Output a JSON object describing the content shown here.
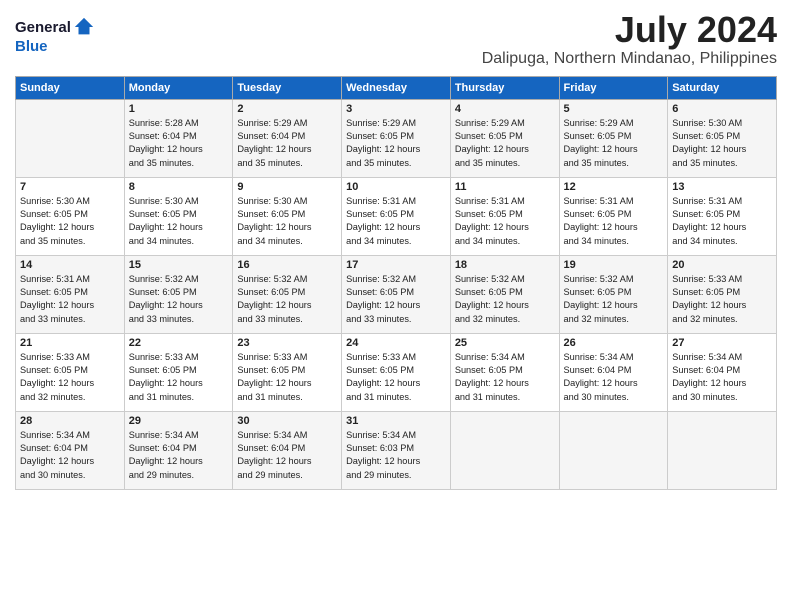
{
  "header": {
    "logo_general": "General",
    "logo_blue": "Blue",
    "month_year": "July 2024",
    "location": "Dalipuga, Northern Mindanao, Philippines"
  },
  "days_of_week": [
    "Sunday",
    "Monday",
    "Tuesday",
    "Wednesday",
    "Thursday",
    "Friday",
    "Saturday"
  ],
  "weeks": [
    [
      {
        "day": "",
        "info": ""
      },
      {
        "day": "1",
        "info": "Sunrise: 5:28 AM\nSunset: 6:04 PM\nDaylight: 12 hours\nand 35 minutes."
      },
      {
        "day": "2",
        "info": "Sunrise: 5:29 AM\nSunset: 6:04 PM\nDaylight: 12 hours\nand 35 minutes."
      },
      {
        "day": "3",
        "info": "Sunrise: 5:29 AM\nSunset: 6:05 PM\nDaylight: 12 hours\nand 35 minutes."
      },
      {
        "day": "4",
        "info": "Sunrise: 5:29 AM\nSunset: 6:05 PM\nDaylight: 12 hours\nand 35 minutes."
      },
      {
        "day": "5",
        "info": "Sunrise: 5:29 AM\nSunset: 6:05 PM\nDaylight: 12 hours\nand 35 minutes."
      },
      {
        "day": "6",
        "info": "Sunrise: 5:30 AM\nSunset: 6:05 PM\nDaylight: 12 hours\nand 35 minutes."
      }
    ],
    [
      {
        "day": "7",
        "info": "Sunrise: 5:30 AM\nSunset: 6:05 PM\nDaylight: 12 hours\nand 35 minutes."
      },
      {
        "day": "8",
        "info": "Sunrise: 5:30 AM\nSunset: 6:05 PM\nDaylight: 12 hours\nand 34 minutes."
      },
      {
        "day": "9",
        "info": "Sunrise: 5:30 AM\nSunset: 6:05 PM\nDaylight: 12 hours\nand 34 minutes."
      },
      {
        "day": "10",
        "info": "Sunrise: 5:31 AM\nSunset: 6:05 PM\nDaylight: 12 hours\nand 34 minutes."
      },
      {
        "day": "11",
        "info": "Sunrise: 5:31 AM\nSunset: 6:05 PM\nDaylight: 12 hours\nand 34 minutes."
      },
      {
        "day": "12",
        "info": "Sunrise: 5:31 AM\nSunset: 6:05 PM\nDaylight: 12 hours\nand 34 minutes."
      },
      {
        "day": "13",
        "info": "Sunrise: 5:31 AM\nSunset: 6:05 PM\nDaylight: 12 hours\nand 34 minutes."
      }
    ],
    [
      {
        "day": "14",
        "info": "Sunrise: 5:31 AM\nSunset: 6:05 PM\nDaylight: 12 hours\nand 33 minutes."
      },
      {
        "day": "15",
        "info": "Sunrise: 5:32 AM\nSunset: 6:05 PM\nDaylight: 12 hours\nand 33 minutes."
      },
      {
        "day": "16",
        "info": "Sunrise: 5:32 AM\nSunset: 6:05 PM\nDaylight: 12 hours\nand 33 minutes."
      },
      {
        "day": "17",
        "info": "Sunrise: 5:32 AM\nSunset: 6:05 PM\nDaylight: 12 hours\nand 33 minutes."
      },
      {
        "day": "18",
        "info": "Sunrise: 5:32 AM\nSunset: 6:05 PM\nDaylight: 12 hours\nand 32 minutes."
      },
      {
        "day": "19",
        "info": "Sunrise: 5:32 AM\nSunset: 6:05 PM\nDaylight: 12 hours\nand 32 minutes."
      },
      {
        "day": "20",
        "info": "Sunrise: 5:33 AM\nSunset: 6:05 PM\nDaylight: 12 hours\nand 32 minutes."
      }
    ],
    [
      {
        "day": "21",
        "info": "Sunrise: 5:33 AM\nSunset: 6:05 PM\nDaylight: 12 hours\nand 32 minutes."
      },
      {
        "day": "22",
        "info": "Sunrise: 5:33 AM\nSunset: 6:05 PM\nDaylight: 12 hours\nand 31 minutes."
      },
      {
        "day": "23",
        "info": "Sunrise: 5:33 AM\nSunset: 6:05 PM\nDaylight: 12 hours\nand 31 minutes."
      },
      {
        "day": "24",
        "info": "Sunrise: 5:33 AM\nSunset: 6:05 PM\nDaylight: 12 hours\nand 31 minutes."
      },
      {
        "day": "25",
        "info": "Sunrise: 5:34 AM\nSunset: 6:05 PM\nDaylight: 12 hours\nand 31 minutes."
      },
      {
        "day": "26",
        "info": "Sunrise: 5:34 AM\nSunset: 6:04 PM\nDaylight: 12 hours\nand 30 minutes."
      },
      {
        "day": "27",
        "info": "Sunrise: 5:34 AM\nSunset: 6:04 PM\nDaylight: 12 hours\nand 30 minutes."
      }
    ],
    [
      {
        "day": "28",
        "info": "Sunrise: 5:34 AM\nSunset: 6:04 PM\nDaylight: 12 hours\nand 30 minutes."
      },
      {
        "day": "29",
        "info": "Sunrise: 5:34 AM\nSunset: 6:04 PM\nDaylight: 12 hours\nand 29 minutes."
      },
      {
        "day": "30",
        "info": "Sunrise: 5:34 AM\nSunset: 6:04 PM\nDaylight: 12 hours\nand 29 minutes."
      },
      {
        "day": "31",
        "info": "Sunrise: 5:34 AM\nSunset: 6:03 PM\nDaylight: 12 hours\nand 29 minutes."
      },
      {
        "day": "",
        "info": ""
      },
      {
        "day": "",
        "info": ""
      },
      {
        "day": "",
        "info": ""
      }
    ]
  ]
}
